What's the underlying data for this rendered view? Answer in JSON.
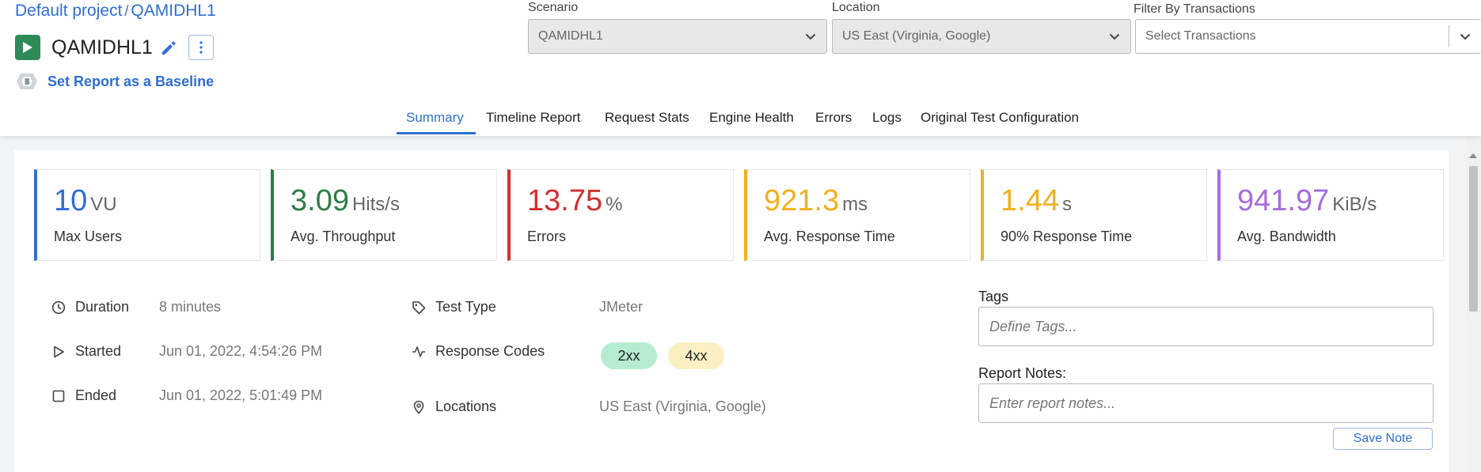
{
  "breadcrumb": {
    "project": "Default project",
    "separator": "/",
    "test": "QAMIDHL1"
  },
  "test": {
    "name": "QAMIDHL1"
  },
  "baseline": {
    "label": "Set Report as a Baseline"
  },
  "filters": {
    "scenario": {
      "label": "Scenario",
      "value": "QAMIDHL1"
    },
    "location": {
      "label": "Location",
      "value": "US East (Virginia, Google)"
    },
    "transactions": {
      "label": "Filter By Transactions",
      "placeholder": "Select Transactions"
    }
  },
  "tabs": [
    {
      "label": "Summary",
      "active": true
    },
    {
      "label": "Timeline Report",
      "active": false
    },
    {
      "label": "Request Stats",
      "active": false
    },
    {
      "label": "Engine Health",
      "active": false
    },
    {
      "label": "Errors",
      "active": false
    },
    {
      "label": "Logs",
      "active": false
    },
    {
      "label": "Original Test Configuration",
      "active": false
    }
  ],
  "metrics": [
    {
      "value": "10",
      "unit": "VU",
      "label": "Max Users",
      "color": "#2e6ed6"
    },
    {
      "value": "3.09",
      "unit": "Hits/s",
      "label": "Avg. Throughput",
      "color": "#2e7d45"
    },
    {
      "value": "13.75",
      "unit": "%",
      "label": "Errors",
      "color": "#d32f2f"
    },
    {
      "value": "921.3",
      "unit": "ms",
      "label": "Avg. Response Time",
      "color": "#f2b01e"
    },
    {
      "value": "1.44",
      "unit": "s",
      "label": "90% Response Time",
      "color": "#f2b01e"
    },
    {
      "value": "941.97",
      "unit": "KiB/s",
      "label": "Avg. Bandwidth",
      "color": "#a66cdb"
    }
  ],
  "details": {
    "duration": {
      "key": "Duration",
      "value": "8 minutes"
    },
    "started": {
      "key": "Started",
      "value": "Jun 01, 2022, 4:54:26 PM"
    },
    "ended": {
      "key": "Ended",
      "value": "Jun 01, 2022, 5:01:49 PM"
    },
    "test_type": {
      "key": "Test Type",
      "value": "JMeter"
    },
    "response_codes": {
      "key": "Response Codes",
      "codes": [
        "2xx",
        "4xx"
      ]
    },
    "locations": {
      "key": "Locations",
      "value": "US East (Virginia, Google)"
    }
  },
  "tags": {
    "label": "Tags",
    "placeholder": "Define Tags..."
  },
  "notes": {
    "label": "Report Notes:",
    "placeholder": "Enter report notes...",
    "save_label": "Save Note"
  },
  "colors": {
    "accent": "#2e6ed6",
    "run": "#2e8b57",
    "badge_2xx": "#b5ecd0",
    "badge_4xx": "#fbefc4"
  }
}
